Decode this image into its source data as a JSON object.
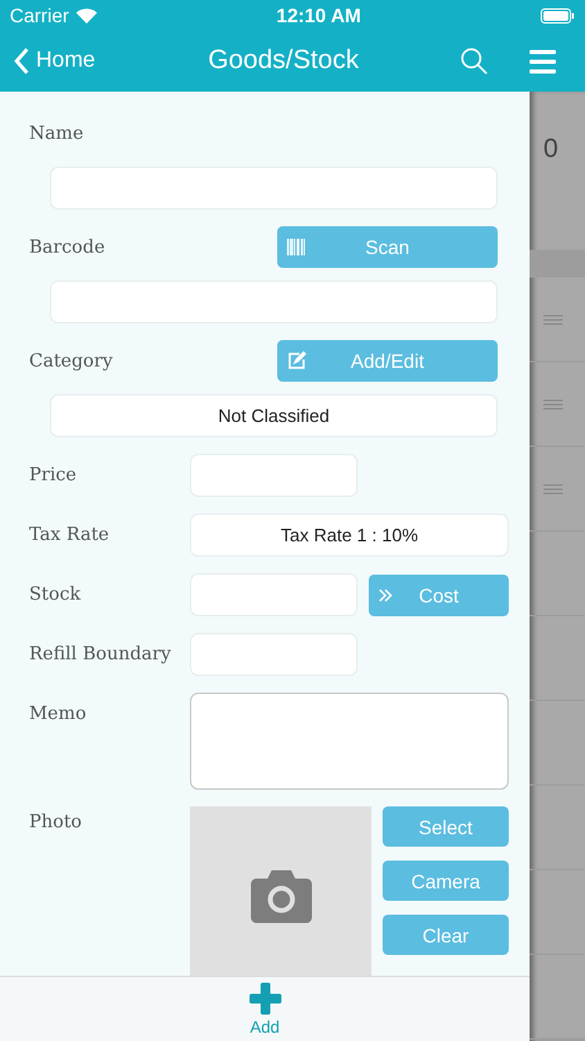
{
  "status_bar": {
    "carrier": "Carrier",
    "time": "12:10 AM"
  },
  "nav": {
    "back": "Home",
    "title": "Goods/Stock"
  },
  "form": [
    {
      "kind": "full",
      "label": "Name"
    },
    {
      "kind": "full",
      "label": "Barcode",
      "button": {
        "label": "Scan",
        "kind": "barcode"
      }
    },
    {
      "kind": "full",
      "label": "Category",
      "button": {
        "label": "Add/Edit",
        "kind": "edit"
      },
      "value": "Not Classified"
    },
    {
      "kind": "short",
      "label": "Price"
    },
    {
      "kind": "wide",
      "label": "Tax Rate",
      "value": "Tax Rate 1 : 10%"
    },
    {
      "kind": "short",
      "label": "Stock",
      "button": {
        "label": "Cost",
        "kind": "chevrons"
      }
    },
    {
      "kind": "short",
      "label": "Refill Boundary"
    },
    {
      "kind": "memo",
      "label": "Memo"
    }
  ],
  "photo": {
    "label": "Photo",
    "buttons": [
      "Select",
      "Camera",
      "Clear"
    ]
  },
  "bottom_bar": {
    "add": "Add"
  },
  "background_list": {
    "partial_text": "0"
  }
}
